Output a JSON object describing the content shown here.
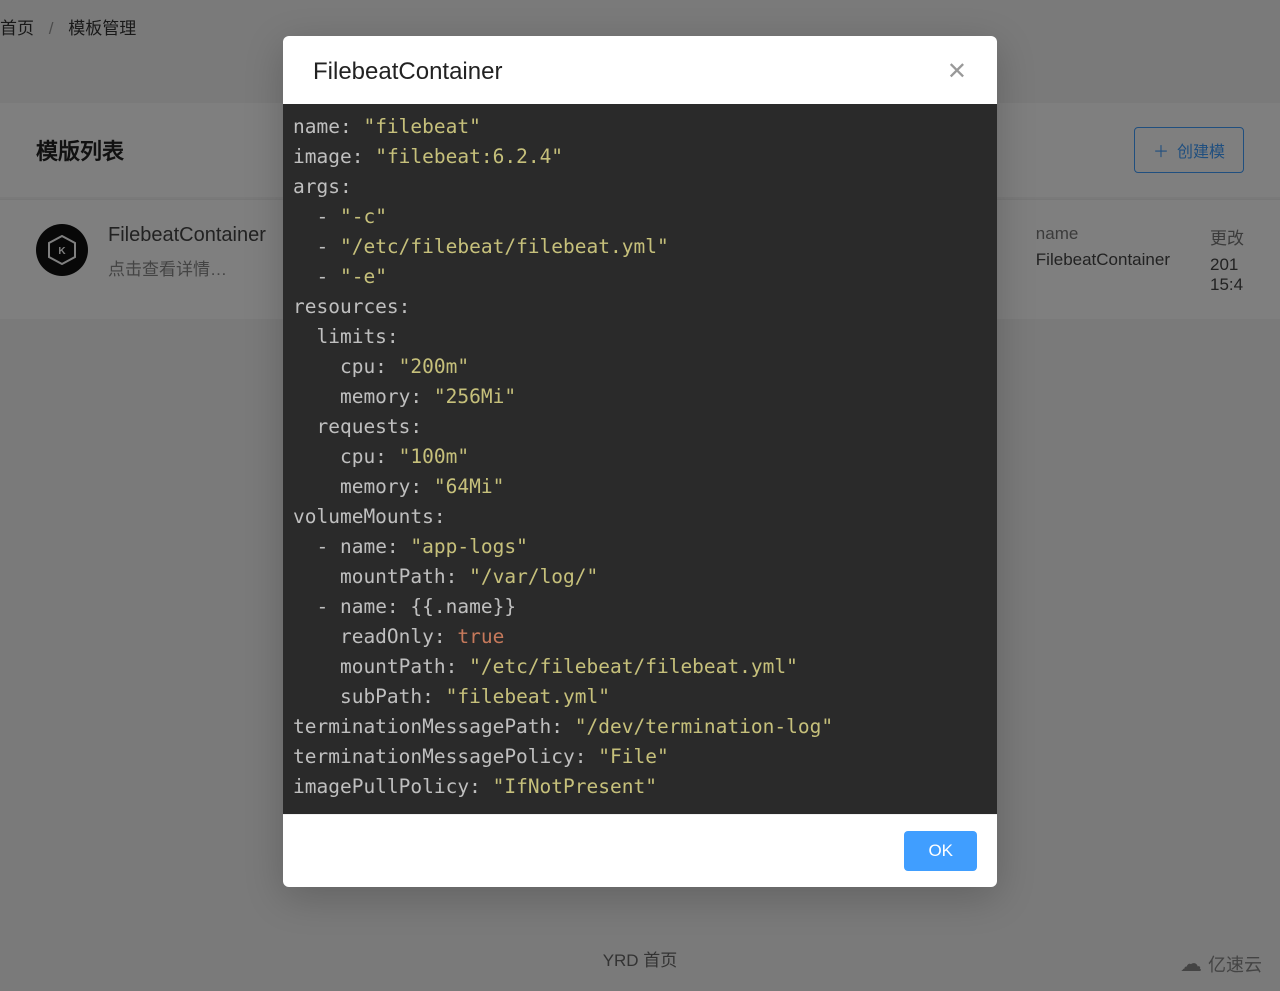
{
  "breadcrumb": {
    "home": "首页",
    "current": "模板管理"
  },
  "section": {
    "title": "模版列表",
    "create_button": "创建模"
  },
  "row": {
    "title": "FilebeatContainer",
    "subtitle": "点击查看详情…",
    "col_name_label": "name",
    "col_name_value": "FilebeatContainer",
    "col_time_label": "更改",
    "col_time_value1": "201",
    "col_time_value2": "15:4"
  },
  "footer": {
    "text": "YRD 首页",
    "watermark": "亿速云"
  },
  "modal": {
    "title": "FilebeatContainer",
    "ok": "OK"
  },
  "yaml": {
    "l1_k": "name:",
    "l1_v": "\"filebeat\"",
    "l2_k": "image:",
    "l2_v": "\"filebeat:6.2.4\"",
    "l3": "args:",
    "l4_p": "  - ",
    "l4_v": "\"-c\"",
    "l5_p": "  - ",
    "l5_v": "\"/etc/filebeat/filebeat.yml\"",
    "l6_p": "  - ",
    "l6_v": "\"-e\"",
    "l7": "resources:",
    "l8": "  limits:",
    "l9_k": "    cpu:",
    "l9_v": "\"200m\"",
    "l10_k": "    memory:",
    "l10_v": "\"256Mi\"",
    "l11": "  requests:",
    "l12_k": "    cpu:",
    "l12_v": "\"100m\"",
    "l13_k": "    memory:",
    "l13_v": "\"64Mi\"",
    "l14": "volumeMounts:",
    "l15_p": "  - ",
    "l15_k": "name:",
    "l15_v": "\"app-logs\"",
    "l16_k": "    mountPath:",
    "l16_v": "\"/var/log/\"",
    "l17_p": "  - ",
    "l17_k": "name:",
    "l17_v": "{{.name}}",
    "l18_k": "    readOnly:",
    "l18_v": "true",
    "l19_k": "    mountPath:",
    "l19_v": "\"/etc/filebeat/filebeat.yml\"",
    "l20_k": "    subPath:",
    "l20_v": "\"filebeat.yml\"",
    "l21_k": "terminationMessagePath:",
    "l21_v": "\"/dev/termination-log\"",
    "l22_k": "terminationMessagePolicy:",
    "l22_v": "\"File\"",
    "l23_k": "imagePullPolicy:",
    "l23_v": "\"IfNotPresent\""
  }
}
